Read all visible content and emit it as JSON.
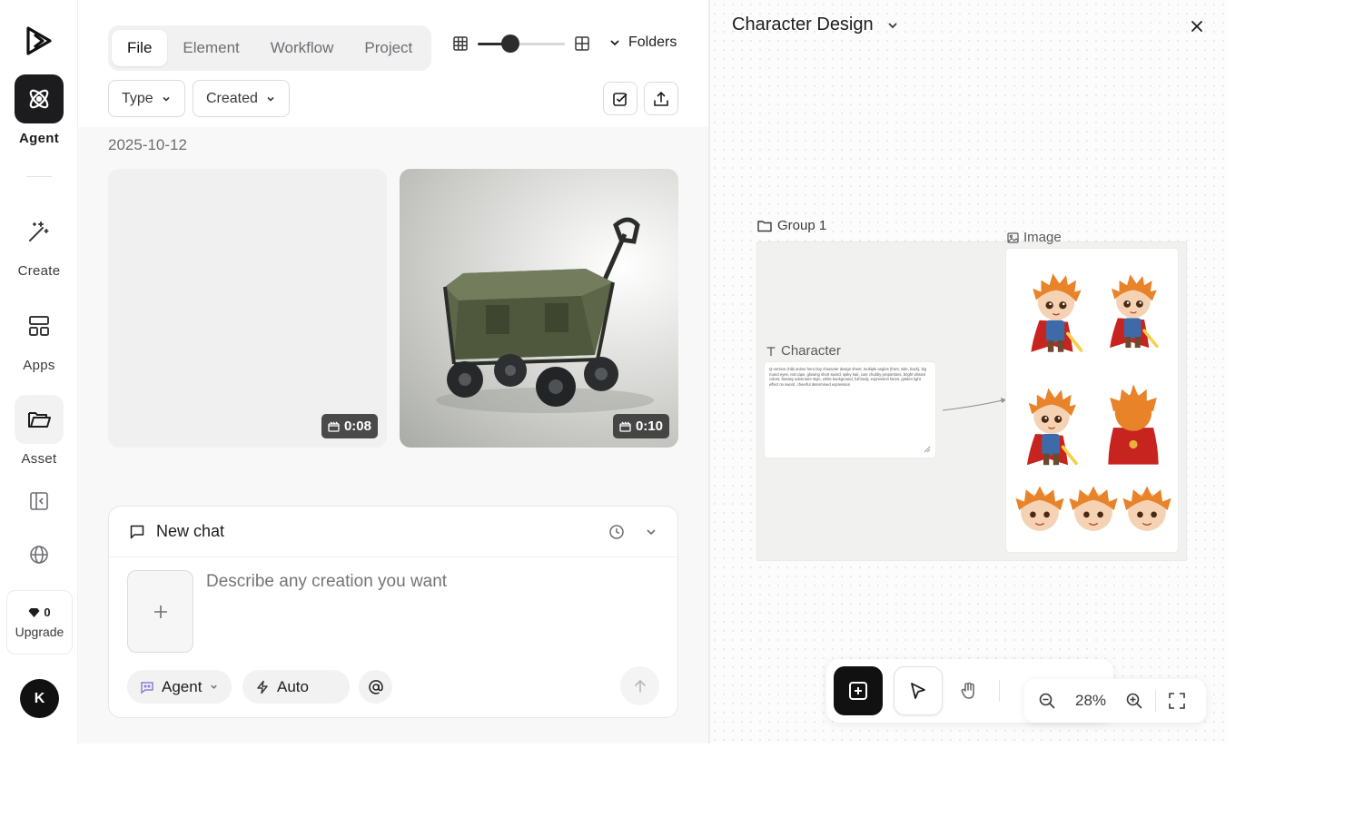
{
  "sidebar": {
    "items": [
      {
        "label": "Agent",
        "icon": "atom-icon"
      },
      {
        "label": "Create",
        "icon": "magic-wand-icon"
      },
      {
        "label": "Apps",
        "icon": "apps-layout-icon"
      },
      {
        "label": "Asset",
        "icon": "folder-open-icon"
      }
    ],
    "credits": "0",
    "upgrade_label": "Upgrade",
    "avatar_initial": "K"
  },
  "assets": {
    "tabs": [
      {
        "label": "File",
        "active": true
      },
      {
        "label": "Element",
        "active": false
      },
      {
        "label": "Workflow",
        "active": false
      },
      {
        "label": "Project",
        "active": false
      }
    ],
    "grid_size_level": 0.38,
    "folders_label": "Folders",
    "filters": {
      "type_label": "Type",
      "created_label": "Created"
    },
    "date_group": "2025-10-12",
    "cards": [
      {
        "kind": "video",
        "duration": "0:08",
        "thumbnail": "blank"
      },
      {
        "kind": "video",
        "duration": "0:10",
        "thumbnail": "wagon-photo"
      }
    ]
  },
  "chat": {
    "title": "New chat",
    "placeholder": "Describe any creation you want",
    "agent_label": "Agent",
    "mode_label": "Auto"
  },
  "canvas": {
    "title": "Character Design",
    "group_label": "Group 1",
    "text_node_label": "Character",
    "text_node_content": "Q-version chibi anime hero boy character design sheet, multiple angles (front, side, back), big round eyes, red cape, glowing short sword, spiky hair, cute chubby proportions, bright vibrant colors, fantasy adventure style, white background, full body, expression faces, golden light effect on sword, cheerful determined expression",
    "image_node_label": "Image",
    "zoom": "28%",
    "colors": {
      "accent": "#111111",
      "hair": "#e8832a",
      "cape": "#c8241f",
      "tunic": "#3f6aa8"
    }
  }
}
